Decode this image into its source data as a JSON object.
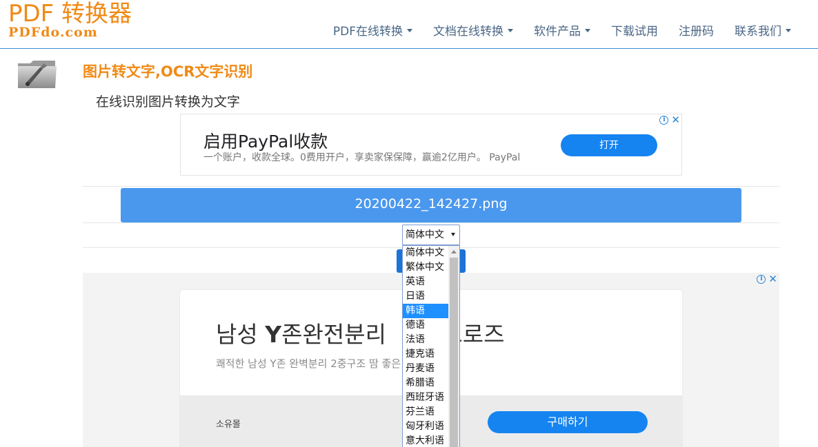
{
  "logo": {
    "title": "PDF 转换器",
    "subtitle": "PDFdo.com"
  },
  "nav": [
    {
      "label": "PDF在线转换",
      "dropdown": true
    },
    {
      "label": "文档在线转换",
      "dropdown": true
    },
    {
      "label": "软件产品",
      "dropdown": true
    },
    {
      "label": "下载试用",
      "dropdown": false
    },
    {
      "label": "注册码",
      "dropdown": false
    },
    {
      "label": "联系我们",
      "dropdown": true
    }
  ],
  "page": {
    "title": "图片转文字,OCR文字识别",
    "subtitle": "在线识别图片转换为文字"
  },
  "ad1": {
    "title": "启用PayPal收款",
    "description": "一个账户，收款全球。0费用开户，享卖家保保障，赢逾2亿用户。 PayPal",
    "button": "打开"
  },
  "file": {
    "name": "20200422_142427.png"
  },
  "language_select": {
    "value": "简体中文",
    "options": [
      "简体中文",
      "繁体中文",
      "英语",
      "日语",
      "韩语",
      "德语",
      "法语",
      "捷克语",
      "丹麦语",
      "希腊语",
      "西班牙语",
      "芬兰语",
      "匈牙利语",
      "意大利语"
    ],
    "highlighted": "韩语"
  },
  "ad2": {
    "title_pre": "남성 ",
    "title_bold": "Y",
    "title_post": "존완전분리 ",
    "title_hidden": "",
    "title_end": "드로즈",
    "description": "쾌적한 남성 Y존 완벽분리 2중구조 땀 좋은 드로즈",
    "brand": "소유몰",
    "button": "구매하기"
  },
  "colors": {
    "brand_orange": "#f08a16",
    "nav_text": "#4a6685",
    "file_bar": "#4a98ee",
    "ad_button": "#1583f0",
    "highlight": "#1e90ff"
  }
}
